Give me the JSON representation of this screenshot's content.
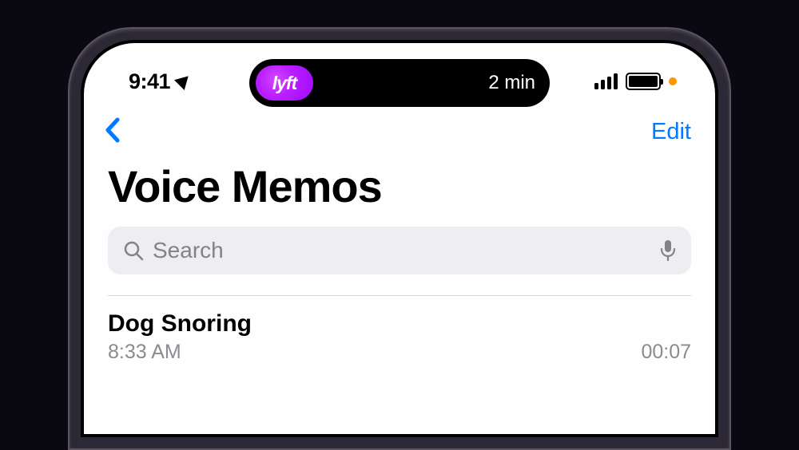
{
  "status": {
    "time": "9:41",
    "island_app_label": "lyft",
    "island_eta": "2 min"
  },
  "nav": {
    "edit_label": "Edit"
  },
  "page": {
    "title": "Voice Memos"
  },
  "search": {
    "placeholder": "Search"
  },
  "memos": [
    {
      "title": "Dog Snoring",
      "time": "8:33 AM",
      "duration": "00:07"
    }
  ]
}
